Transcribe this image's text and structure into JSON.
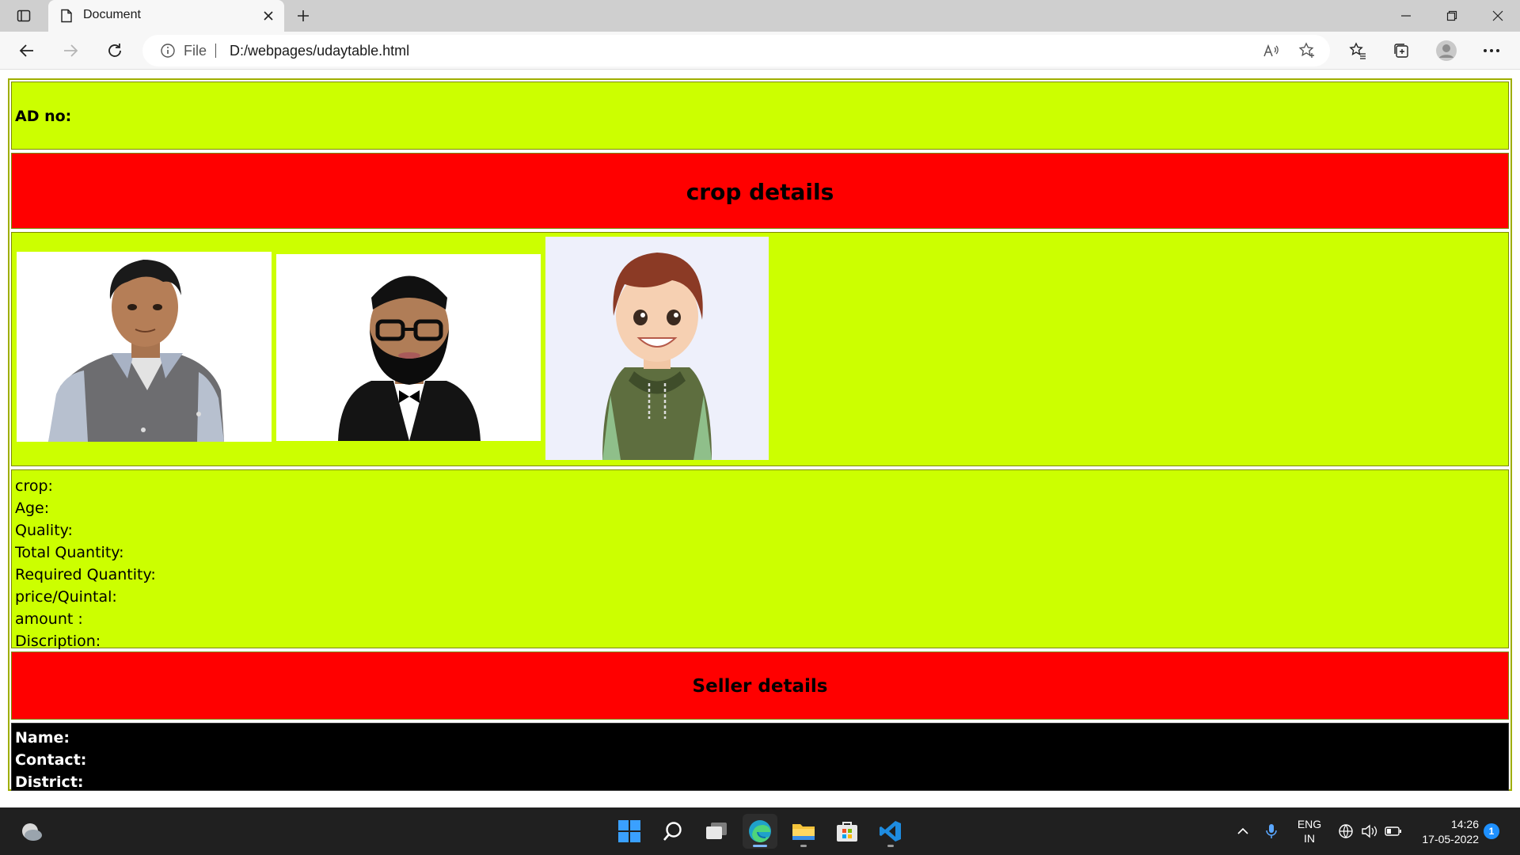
{
  "browser": {
    "tab_title": "Document",
    "address_scheme_label": "File",
    "url": "D:/webpages/udaytable.html"
  },
  "page": {
    "ad_label": "AD no:",
    "crop_heading": "crop details",
    "fields": [
      "crop:",
      "Age:",
      "Quality:",
      "Total Quantity:",
      "Required Quantity:",
      "price/Quintal:",
      "amount :",
      "Discription:"
    ],
    "seller_heading": "Seller details",
    "contact_fields": [
      "Name:",
      "Contact:",
      "District:"
    ],
    "colors": {
      "lime": "#ccff00",
      "red": "#ff0000",
      "black": "#000000"
    },
    "avatars": [
      "avatar-man-vest",
      "avatar-man-beard-glasses",
      "avatar-boy-hoodie"
    ]
  },
  "taskbar": {
    "language": "ENG",
    "region": "IN",
    "time": "14:26",
    "date": "17-05-2022",
    "notification_count": "1"
  }
}
